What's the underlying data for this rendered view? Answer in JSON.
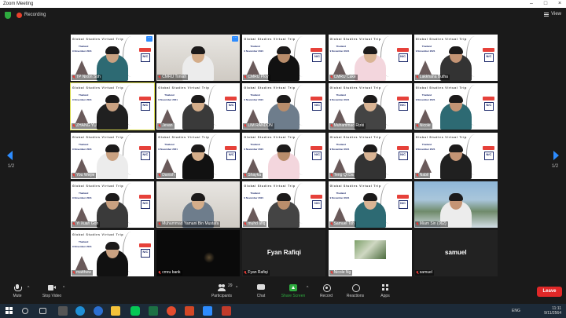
{
  "window": {
    "title": "Zoom Meeting"
  },
  "topbar": {
    "recording_label": "Recording",
    "view_label": "View"
  },
  "pager": {
    "left": "1/2",
    "right": "1/2"
  },
  "background": {
    "title": "Global Studies Virtual Trip",
    "country": "Thailand",
    "date": "9 November 2021",
    "logo_text": "N/C"
  },
  "tiles": [
    {
      "name": "TP Nixon Soh",
      "style": "vbg"
    },
    {
      "name": "CMRU Tonlah",
      "style": "room"
    },
    {
      "name": "CMRU Ploy",
      "style": "vbg"
    },
    {
      "name": "CMRU Cake",
      "style": "vbg"
    },
    {
      "name": "Lakkhana Butha",
      "style": "vbg"
    },
    {
      "name": "ZHANG YU",
      "style": "vbg",
      "active": true
    },
    {
      "name": "Jevan",
      "style": "vbg"
    },
    {
      "name": "LIM RANDON",
      "style": "vbg"
    },
    {
      "name": "Muhammad Rizki",
      "style": "vbg"
    },
    {
      "name": "Nicole",
      "style": "vbg"
    },
    {
      "name": "You Weijie",
      "style": "vbg"
    },
    {
      "name": "Danish",
      "style": "vbg"
    },
    {
      "name": "Shayka",
      "style": "vbg"
    },
    {
      "name": "Teng Qi Da",
      "style": "vbg"
    },
    {
      "name": "Nabil",
      "style": "vbg"
    },
    {
      "name": "Yi Xuan Goh",
      "style": "vbg"
    },
    {
      "name": "Muhammad Yamani Bin Mustafa",
      "style": "room"
    },
    {
      "name": "muhd afiq",
      "style": "vbg"
    },
    {
      "name": "Samuel Toh",
      "style": "vbg"
    },
    {
      "name": "Miam Sin (062)",
      "style": "outdoor"
    },
    {
      "name": "matthew",
      "style": "vbg"
    },
    {
      "name": "cmru bank",
      "style": "black"
    },
    {
      "name": "Fyan Rafiqi",
      "style": "dark",
      "center_label": "Fyan Rafiqi"
    },
    {
      "name": "Nicole Ng",
      "style": "thumb"
    },
    {
      "name": "samuel",
      "style": "dark",
      "center_label": "samuel"
    }
  ],
  "toolbar": {
    "mute": "Mute",
    "stop_video": "Stop Video",
    "participants": "Participants",
    "participants_count": "29",
    "chat": "Chat",
    "share_screen": "Share Screen",
    "record": "Record",
    "reactions": "Reactions",
    "apps": "Apps",
    "leave": "Leave"
  },
  "taskbar": {
    "lang": "ENG",
    "time": "11:11",
    "date": "9/11/2564"
  },
  "colors": {
    "accent": "#2d8cff",
    "share": "#2eab3f",
    "leave": "#e02828",
    "record": "#e8412c"
  }
}
